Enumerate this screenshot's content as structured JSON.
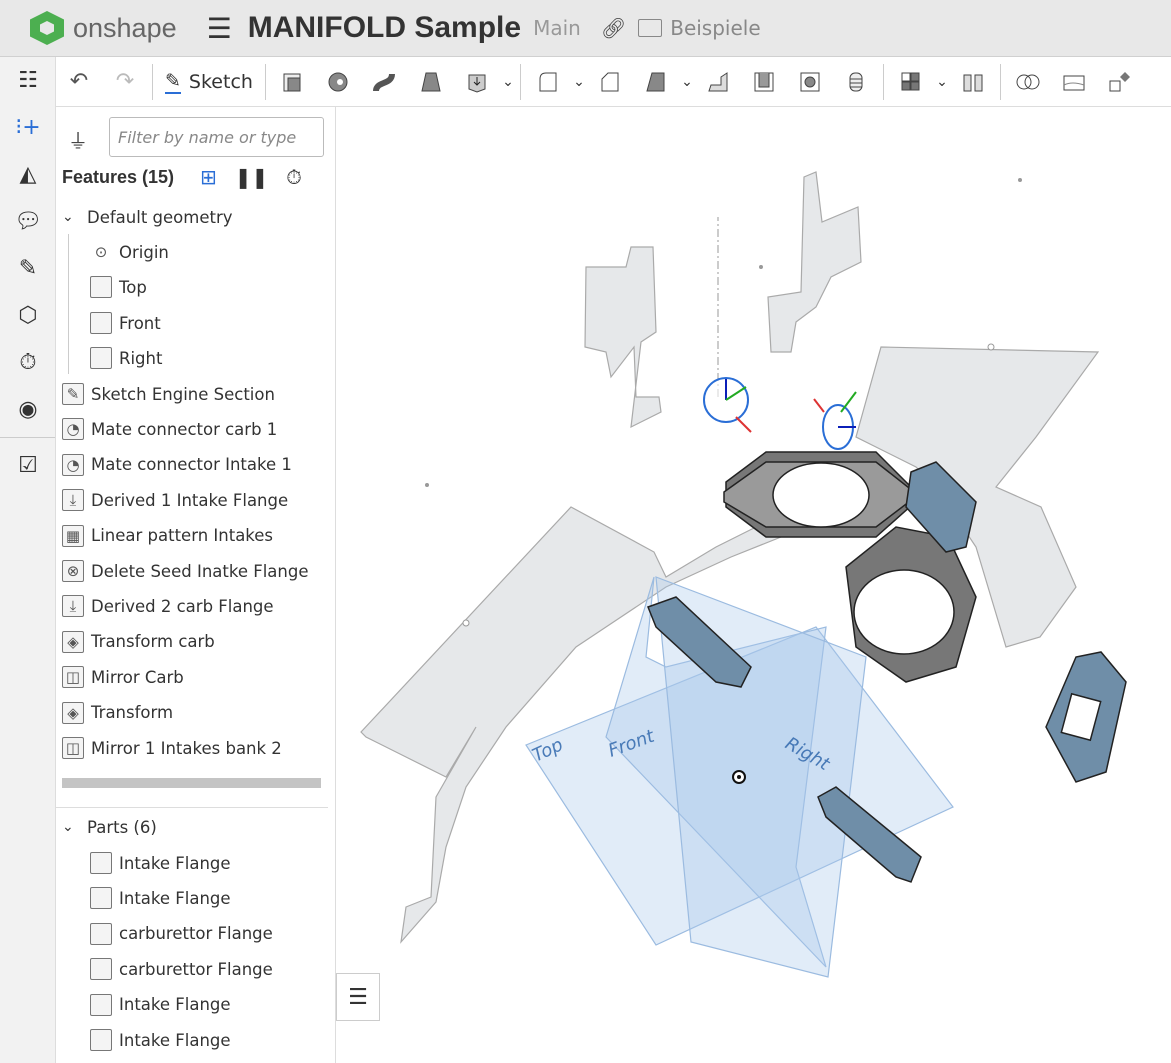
{
  "header": {
    "brand": "onshape",
    "menu_icon": "hamburger-icon",
    "title": "MANIFOLD Sample",
    "branch": "Main",
    "folder": "Beispiele"
  },
  "toolbar": {
    "sketch_label": "Sketch"
  },
  "panel": {
    "filter_placeholder": "Filter by name or type",
    "features_title": "Features (15)",
    "default_geometry": "Default geometry",
    "geometry": [
      "Origin",
      "Top",
      "Front",
      "Right"
    ],
    "features": [
      {
        "label": "Sketch Engine Section",
        "icon": "sketch-icon"
      },
      {
        "label": "Mate connector carb 1",
        "icon": "mate-connector-icon"
      },
      {
        "label": "Mate connector Intake 1",
        "icon": "mate-connector-icon"
      },
      {
        "label": "Derived 1 Intake Flange",
        "icon": "derived-icon"
      },
      {
        "label": "Linear pattern Intakes",
        "icon": "linear-pattern-icon"
      },
      {
        "label": "Delete Seed Inatke Flange",
        "icon": "delete-part-icon"
      },
      {
        "label": "Derived 2 carb Flange",
        "icon": "derived-icon"
      },
      {
        "label": "Transform carb",
        "icon": "transform-icon"
      },
      {
        "label": "Mirror Carb",
        "icon": "mirror-icon"
      },
      {
        "label": "Transform",
        "icon": "transform-icon"
      },
      {
        "label": "Mirror 1 Intakes bank 2",
        "icon": "mirror-icon"
      }
    ],
    "parts_title": "Parts (6)",
    "parts": [
      "Intake Flange",
      "Intake Flange",
      "carburettor Flange",
      "carburettor Flange",
      "Intake Flange",
      "Intake Flange"
    ]
  },
  "viewport": {
    "plane_labels": [
      "Top",
      "Front",
      "Right"
    ]
  }
}
